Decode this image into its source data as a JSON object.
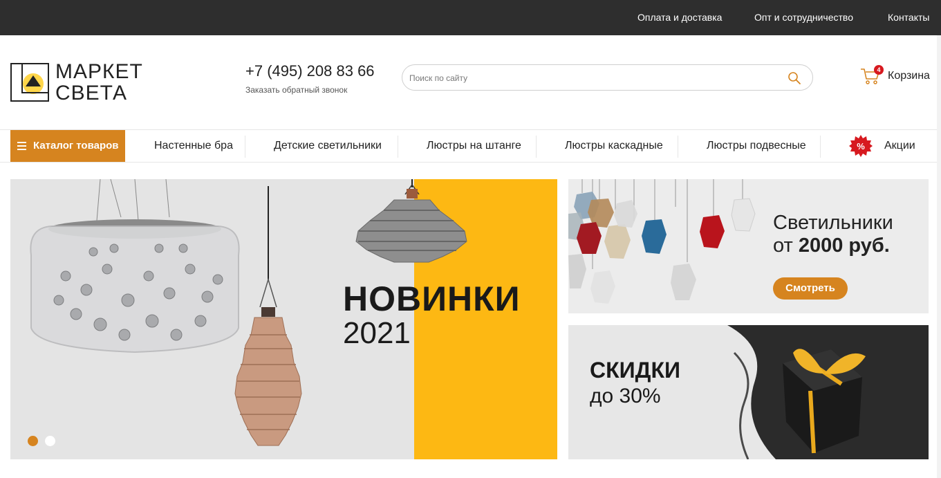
{
  "topbar": {
    "links": [
      "Оплата и доставка",
      "Опт и сотрудничество",
      "Контакты"
    ]
  },
  "header": {
    "logo_line1": "МАРКЕТ",
    "logo_line2": "СВЕТА",
    "phone": "+7 (495) 208 83 66",
    "callback": "Заказать обратный звонок",
    "search_placeholder": "Поиск по сайту",
    "cart_label": "Корзина",
    "cart_count": "4"
  },
  "nav": {
    "catalog_label": "Каталог товаров",
    "items": [
      "Настенные бра",
      "Детские светильники",
      "Люстры на штанге",
      "Люстры каскадные",
      "Люстры подвесные"
    ],
    "sale_label": "Акции",
    "sale_icon_text": "%"
  },
  "hero": {
    "title": "НОВИНКИ",
    "year": "2021"
  },
  "banner1": {
    "line1": "Светильники",
    "line2_prefix": "от",
    "line2_bold": "2000 руб.",
    "button": "Смотреть"
  },
  "banner2": {
    "title": "СКИДКИ",
    "subtitle": "до 30%"
  },
  "colors": {
    "accent": "#d6841f",
    "topbar": "#2e2e2e",
    "hero_yellow": "#fdb813",
    "badge_red": "#d7191f"
  }
}
